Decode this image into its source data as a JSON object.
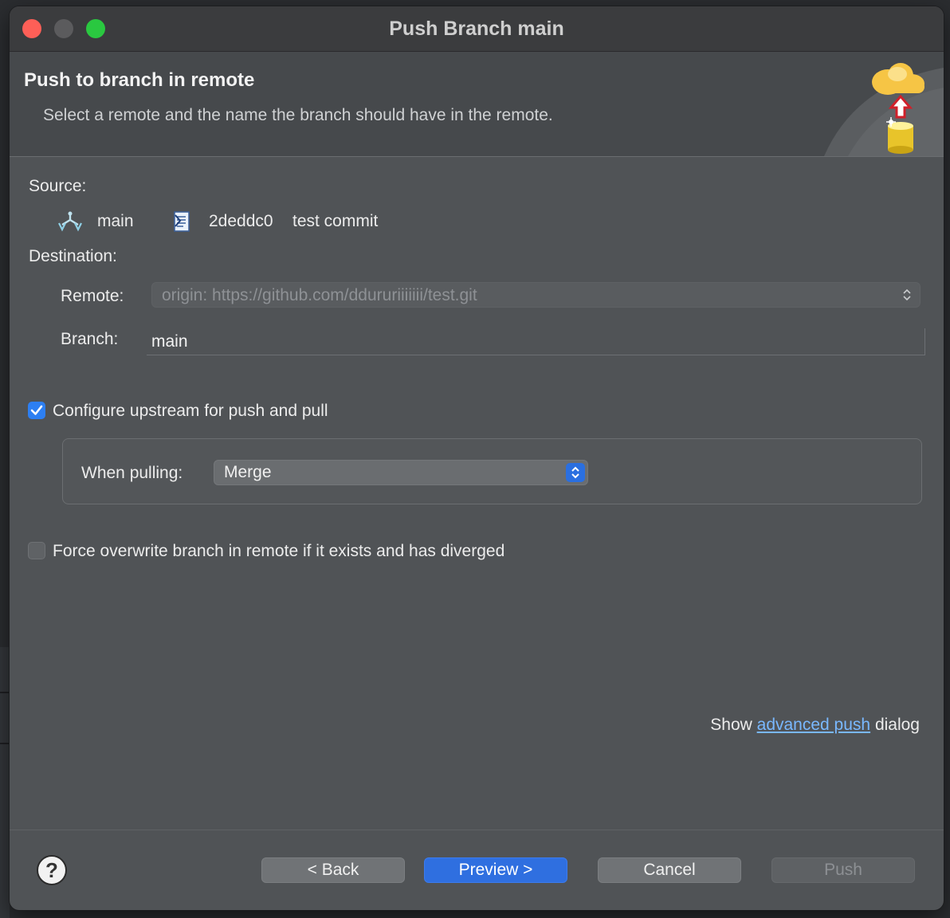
{
  "window": {
    "title": "Push Branch main"
  },
  "banner": {
    "title": "Push to branch in remote",
    "description": "Select a remote and the name the branch should have in the remote."
  },
  "source": {
    "label": "Source:",
    "branch": "main",
    "commit_id": "2deddc0",
    "commit_message": "test commit"
  },
  "destination": {
    "label": "Destination:",
    "remote_label": "Remote:",
    "remote_value": "origin: https://github.com/ddururiiiiiii/test.git",
    "branch_label": "Branch:",
    "branch_value": "main"
  },
  "upstream": {
    "checkbox_label": "Configure upstream for push and pull",
    "checked": true,
    "when_pulling_label": "When pulling:",
    "when_pulling_value": "Merge"
  },
  "force": {
    "checkbox_label": "Force overwrite branch in remote if it exists and has diverged",
    "checked": false
  },
  "advanced": {
    "prefix": "Show",
    "link": "advanced push",
    "suffix": "dialog"
  },
  "buttons": {
    "help": "?",
    "back": "< Back",
    "preview": "Preview >",
    "cancel": "Cancel",
    "push": "Push"
  },
  "colors": {
    "accent": "#2f6fe0",
    "link": "#79b8ff",
    "close": "#fe5f57",
    "maximize": "#2ac840"
  },
  "icons": {
    "branch": "branch-icon",
    "commit": "commit-icon",
    "banner": "cloud-push-icon",
    "help": "help-icon"
  }
}
